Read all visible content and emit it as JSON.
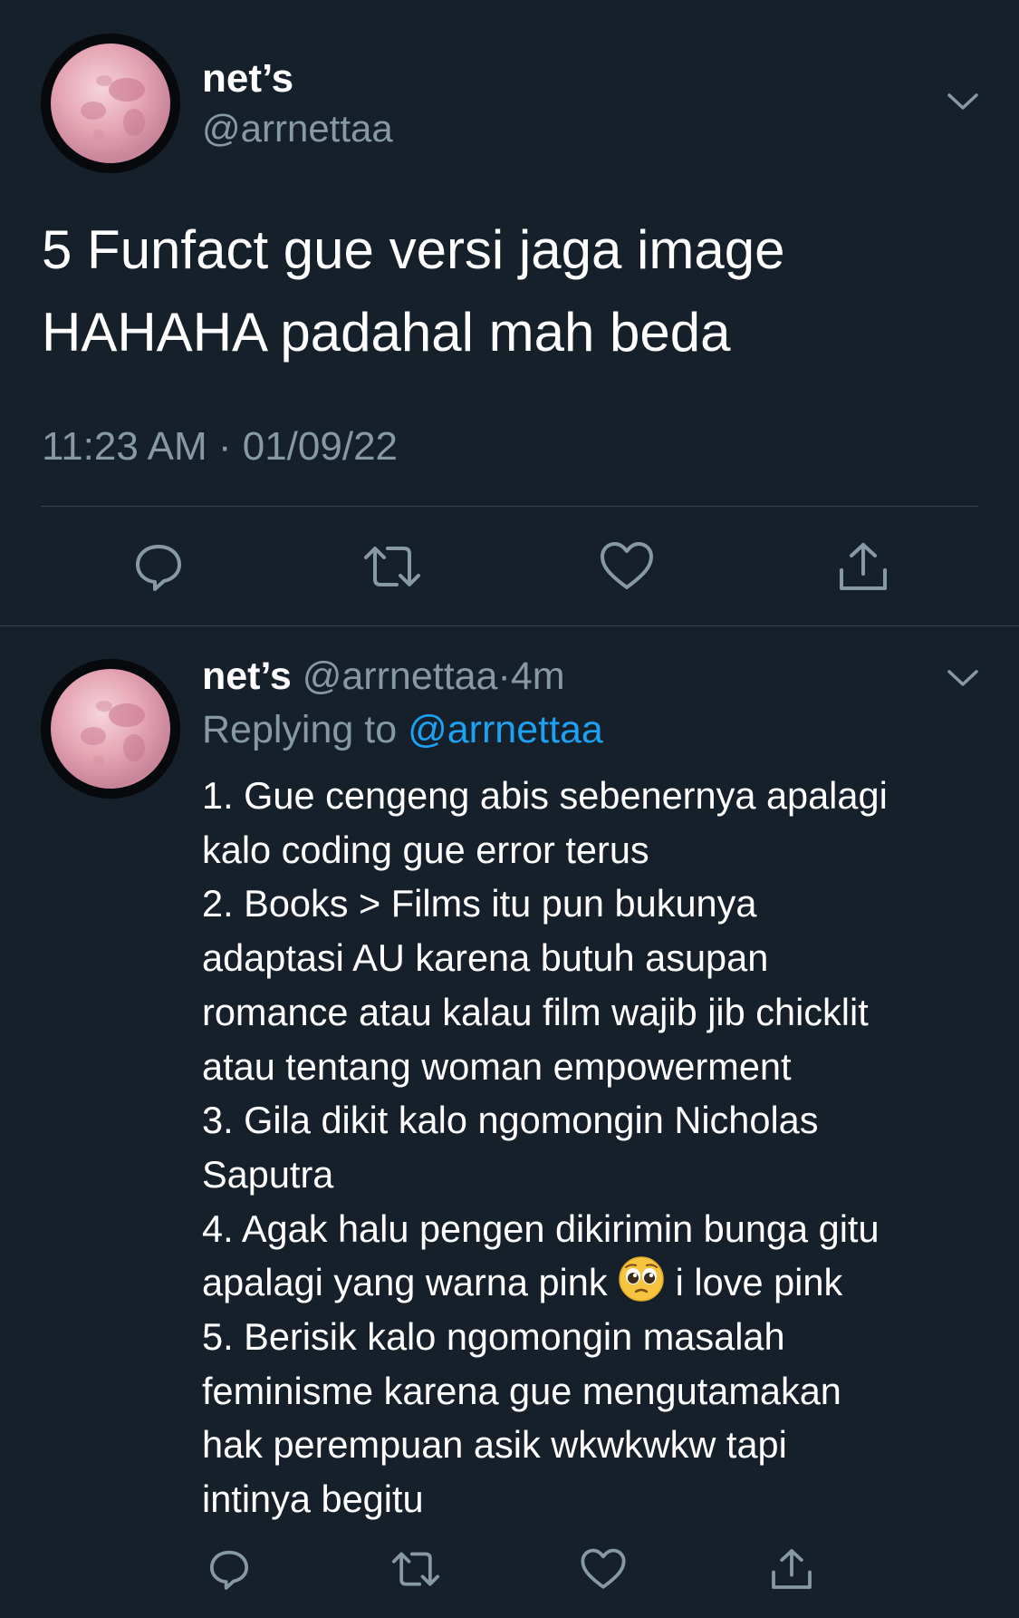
{
  "main_tweet": {
    "display_name": "net’s",
    "handle": "@arrnettaa",
    "text_line1": "5 Funfact gue versi jaga image",
    "text_line2": "HAHAHA padahal mah beda",
    "timestamp": "11:23 AM · 01/09/22",
    "actions": [
      "reply-icon",
      "retweet-icon",
      "like-icon",
      "share-icon"
    ]
  },
  "reply_tweet": {
    "display_name": "net’s",
    "handle": "@arrnettaa",
    "separator": "·",
    "age": "4m",
    "replying_prefix": "Replying to",
    "replying_mention": "@arrnettaa",
    "text_before_emoji": "1. Gue cengeng abis sebenernya apalagi\nkalo coding gue error terus\n2. Books > Films itu pun bukunya\nadaptasi AU karena butuh asupan\nromance atau kalau film wajib jib chicklit\natau tentang woman empowerment\n3. Gila dikit kalo ngomongin Nicholas\nSaputra\n4. Agak halu pengen dikirimin bunga gitu\napalagi yang warna pink ",
    "emoji": "pleading-face-emoji",
    "text_after_emoji": " i love pink\n5. Berisik kalo ngomongin masalah\nfeminisme karena gue mengutamakan\nhak perempuan asik wkwkwkw tapi\nintinya begitu",
    "actions": [
      "reply-icon",
      "retweet-icon",
      "like-icon",
      "share-icon"
    ]
  },
  "colors": {
    "background": "#15202b",
    "primary_text": "#ffffff",
    "secondary_text": "#8899a6",
    "link": "#1da1f2",
    "divider": "#38444d"
  }
}
